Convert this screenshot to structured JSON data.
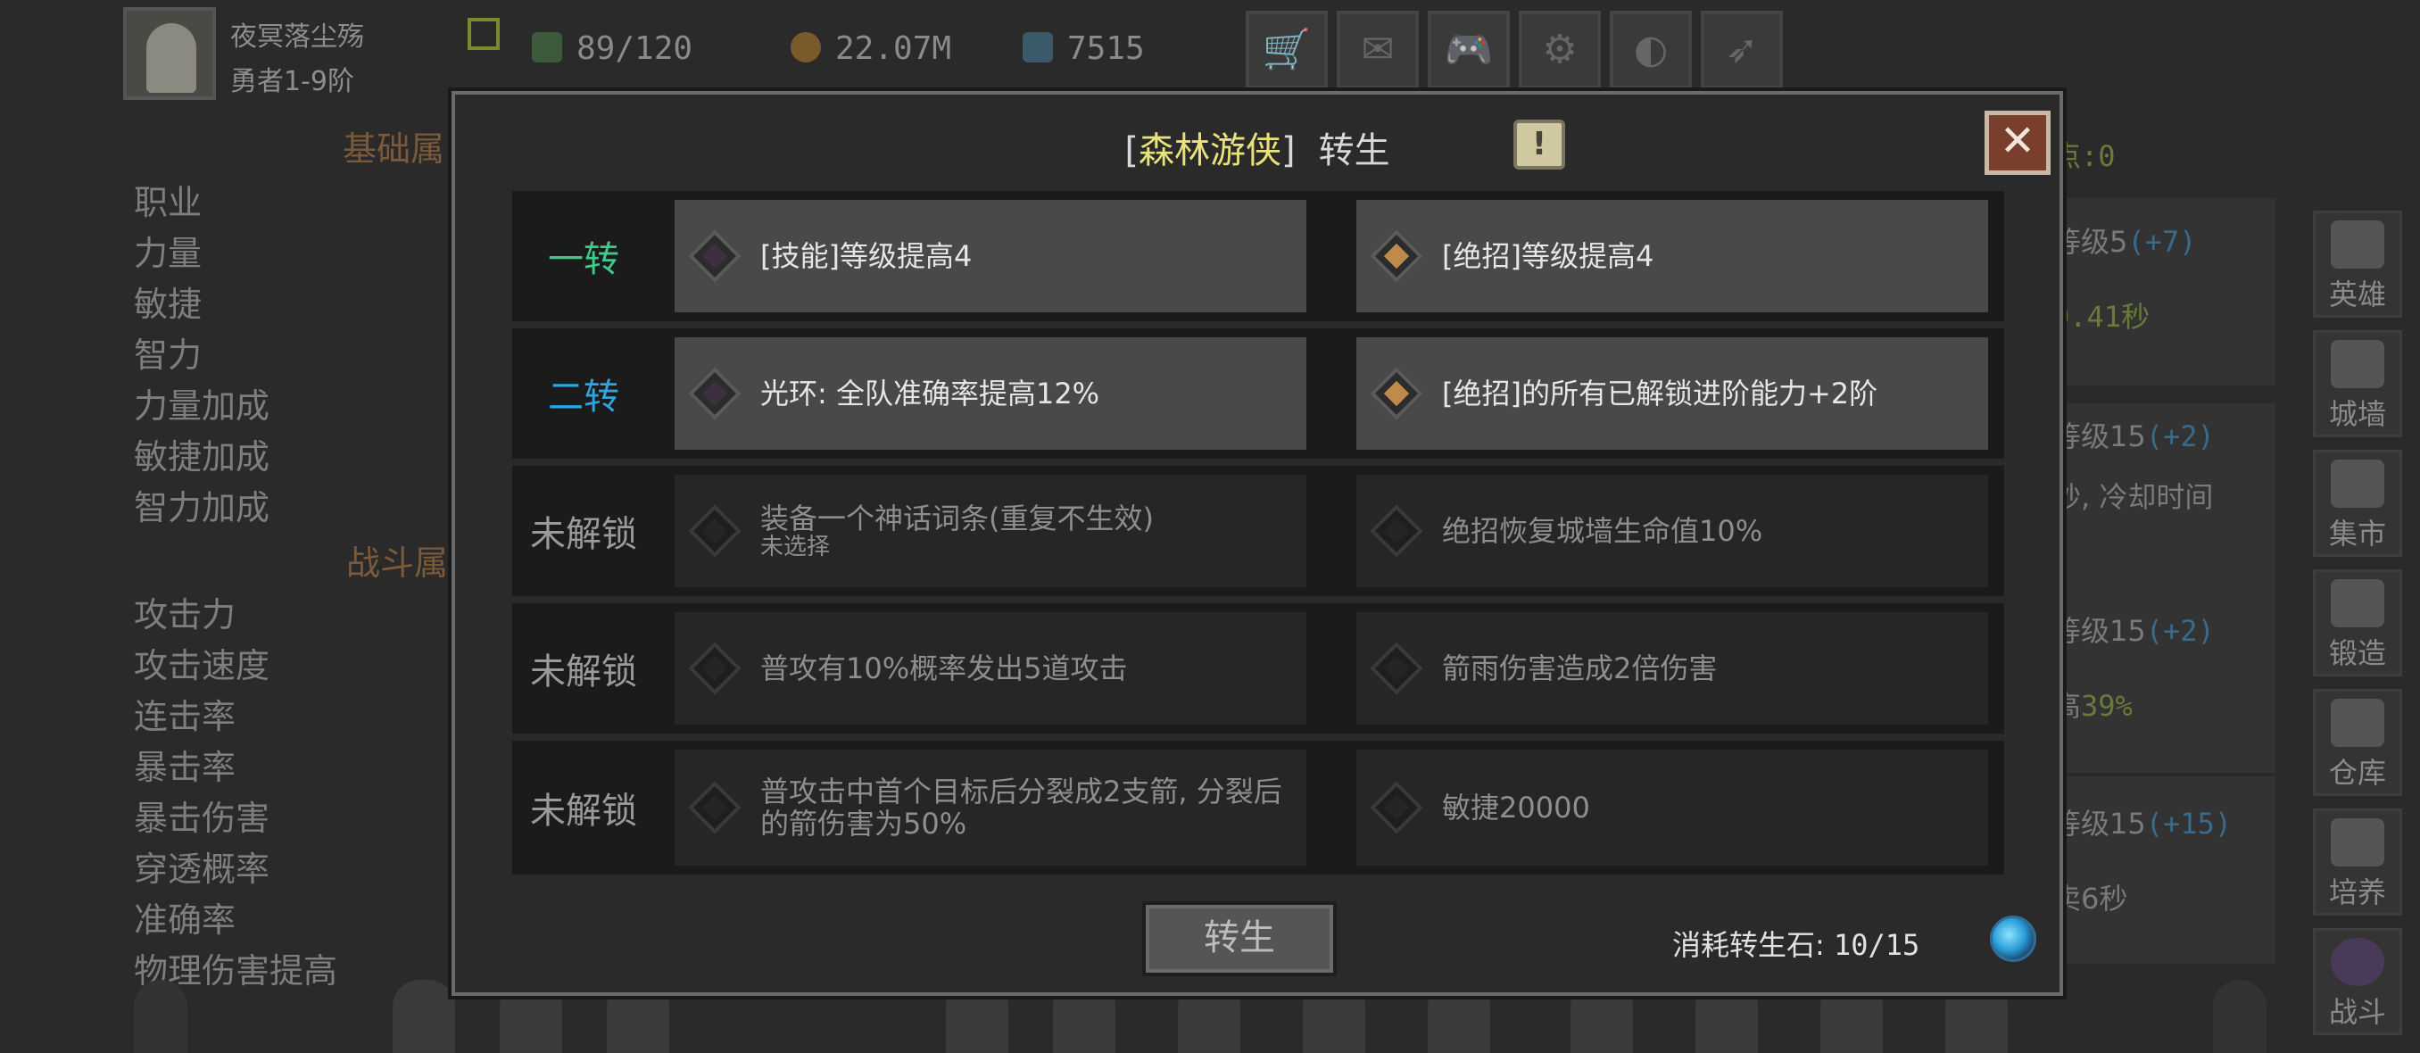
{
  "hud": {
    "player_name": "夜冥落尘殇",
    "rank": "勇者1-9阶",
    "energy": "89/120",
    "gold": "22.07M",
    "gems": "7515"
  },
  "background": {
    "section_basic": "基础属",
    "section_battle": "战斗属",
    "attr_points_label": "点:0",
    "basic_attrs": [
      "职业",
      "力量",
      "敏捷",
      "智力",
      "力量加成",
      "敏捷加成",
      "智力加成"
    ],
    "battle_attrs": [
      "攻击力",
      "攻击速度",
      "连击率",
      "暴击率",
      "暴击伤害",
      "穿透概率",
      "准确率",
      "物理伤害提高"
    ],
    "right_rows": [
      {
        "label": "等级5",
        "extra": "(+7)"
      },
      {
        "label": "",
        "extra": "0.41秒"
      },
      {
        "label": "等级15",
        "extra": "(+2)"
      },
      {
        "label": "秒, 冷却时间",
        "extra": ""
      },
      {
        "label": "等级15",
        "extra": "(+2)"
      },
      {
        "label": "高",
        "extra": "39%"
      },
      {
        "label": "等级15",
        "extra": "(+15)"
      },
      {
        "label": "卖6秒",
        "extra": ""
      }
    ],
    "side_nav": [
      "英雄",
      "城墙",
      "集市",
      "锻造",
      "仓库",
      "培养",
      "战斗"
    ]
  },
  "modal": {
    "title_open": "[",
    "class_name": "森林游侠",
    "title_close": "]",
    "title_suffix": "转生",
    "close_icon": "close-icon",
    "rows": [
      {
        "stage": "一转",
        "left": {
          "text": "[技能]等级提高4",
          "sub": ""
        },
        "right": {
          "text": "[绝招]等级提高4",
          "sub": ""
        }
      },
      {
        "stage": "二转",
        "left": {
          "text": "光环: 全队准确率提高12%",
          "sub": ""
        },
        "right": {
          "text": "[绝招]的所有已解锁进阶能力+2阶",
          "sub": ""
        }
      },
      {
        "stage": "未解锁",
        "left": {
          "text": "装备一个神话词条(重复不生效)",
          "sub": "未选择"
        },
        "right": {
          "text": "绝招恢复城墙生命值10%",
          "sub": ""
        }
      },
      {
        "stage": "未解锁",
        "left": {
          "text": "普攻有10%概率发出5道攻击",
          "sub": ""
        },
        "right": {
          "text": "箭雨伤害造成2倍伤害",
          "sub": ""
        }
      },
      {
        "stage": "未解锁",
        "left": {
          "text": "普攻击中首个目标后分裂成2支箭, 分裂后的箭伤害为50%",
          "sub": ""
        },
        "right": {
          "text": "敏捷20000",
          "sub": ""
        }
      }
    ],
    "rebirth_button": "转生",
    "cost_label": "消耗转生石:",
    "cost_value": "10/15"
  },
  "colors": {
    "stage1": "#3fc98a",
    "stage2": "#2fa5de",
    "class_name": "#e9e27a",
    "close_button": "#7a3f2c"
  }
}
